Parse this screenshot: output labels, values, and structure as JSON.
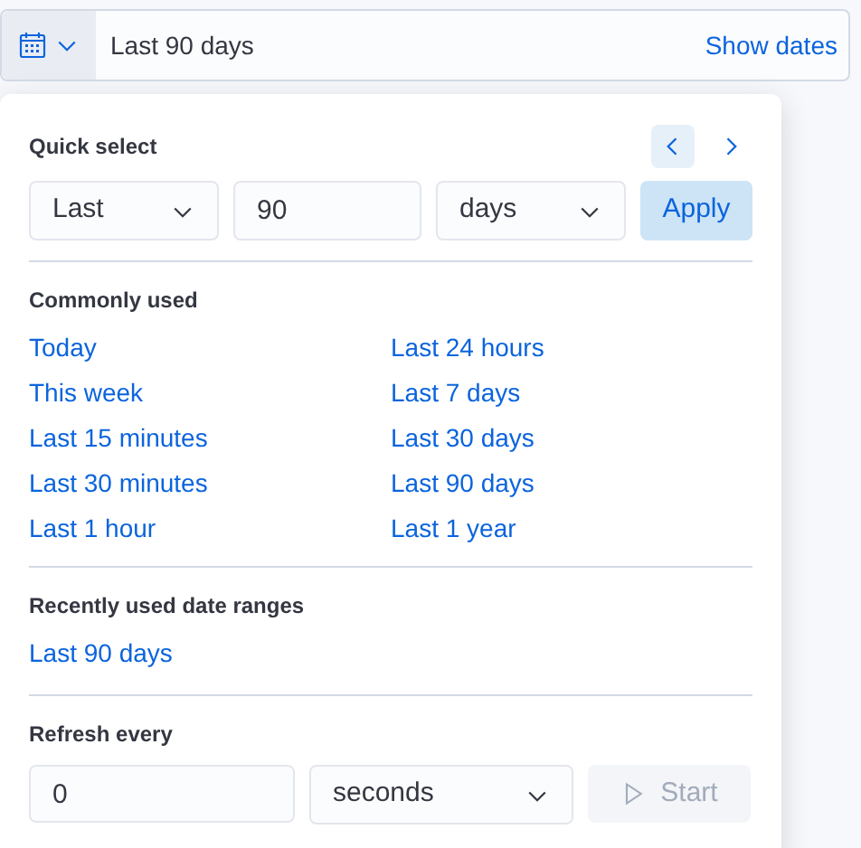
{
  "date_bar": {
    "range": "Last 90 days",
    "show_dates": "Show dates"
  },
  "quick_select": {
    "title": "Quick select",
    "direction": "Last",
    "amount": "90",
    "unit": "days",
    "apply": "Apply"
  },
  "commonly_used": {
    "title": "Commonly used",
    "items": [
      "Today",
      "Last 24 hours",
      "This week",
      "Last 7 days",
      "Last 15 minutes",
      "Last 30 days",
      "Last 30 minutes",
      "Last 90 days",
      "Last 1 hour",
      "Last 1 year"
    ]
  },
  "recently_used": {
    "title": "Recently used date ranges",
    "items": [
      "Last 90 days"
    ]
  },
  "refresh": {
    "title": "Refresh every",
    "interval": "0",
    "unit": "seconds",
    "start": "Start",
    "disabled": true
  }
}
